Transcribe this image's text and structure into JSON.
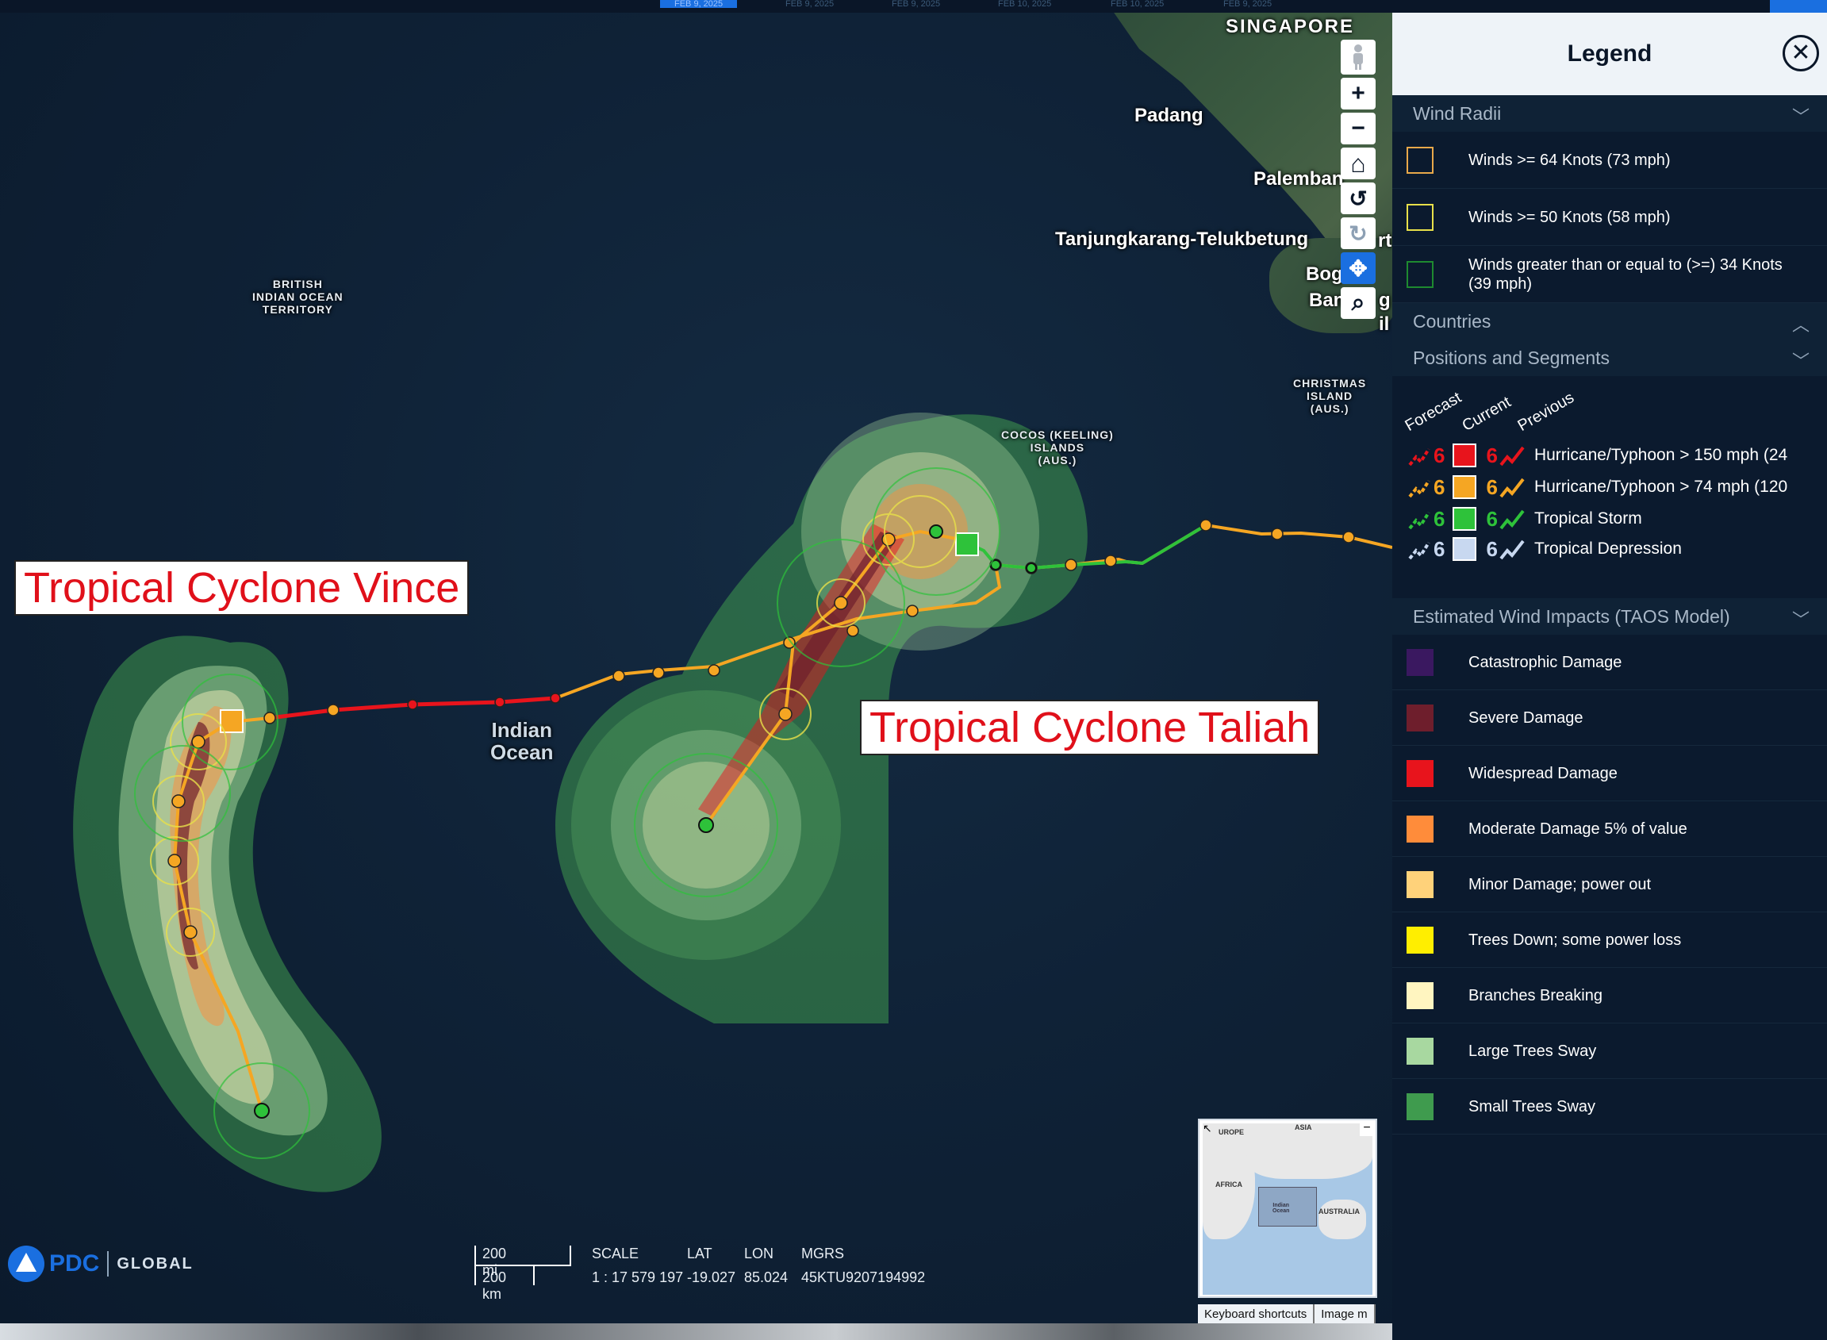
{
  "timeline": {
    "dates": [
      "FEB 9, 2025",
      "FEB 9, 2025",
      "FEB 9, 2025",
      "FEB 10, 2025",
      "FEB 10, 2025",
      "FEB 9, 2025"
    ]
  },
  "map": {
    "labels": {
      "singapore": "SINGAPORE",
      "padang": "Padang",
      "palembang": "Palemban",
      "tanjungkarang": "Tanjungkarang-Telukbetung",
      "bogor": "Bog",
      "bandung": "Ban",
      "north_cut": "rt",
      "cut_g": "g",
      "cut_il": "il",
      "biot": "BRITISH\nINDIAN OCEAN\nTERRITORY",
      "christmas": "CHRISTMAS\nISLAND\n(AUS.)",
      "cocos": "COCOS (KEELING)\nISLANDS\n(AUS.)",
      "ocean": "Indian\nOcean"
    },
    "cyclones": {
      "vince_label": "Tropical Cyclone Vince",
      "taliah_label": "Tropical Cyclone Taliah"
    },
    "colors": {
      "track_forecast": "#f5a623",
      "track_previous_hurricane": "#e8141c",
      "track_storm": "#2ec23a",
      "impact_small_trees": "#3f9b4e",
      "impact_large_trees": "#a8d8a0",
      "impact_branches": "#fff5c0",
      "impact_trees_down": "#ffee00",
      "impact_minor": "#ffd27a",
      "impact_moderate": "#ff8c3a",
      "impact_widespread": "#e8141c",
      "impact_severe": "#6e1e2c",
      "impact_catastrophic": "#3a1860"
    }
  },
  "controls": {
    "zoom_in": "+",
    "zoom_out": "−",
    "home": "⌂",
    "rotate_left": "↺",
    "rotate_right": "↻",
    "pan": "✥",
    "zoom_box": "⌕"
  },
  "status": {
    "scale_top": "200 mi",
    "scale_bottom": "200 km",
    "scale_label": "SCALE",
    "scale_value": "1 : 17 579 197",
    "lat_label": "LAT",
    "lat_value": "-19.027",
    "lon_label": "LON",
    "lon_value": "85.024",
    "mgrs_label": "MGRS",
    "mgrs_value": "45KTU9207194992"
  },
  "branding": {
    "pdc": "PDC",
    "global": "GLOBAL"
  },
  "overview": {
    "europe": "UROPE",
    "asia": "ASIA",
    "africa": "AFRICA",
    "australia": "AUSTRALIA",
    "indian_ocean": "Indian\nOcean",
    "minimize": "−"
  },
  "attribution": {
    "keyboard": "Keyboard shortcuts",
    "image": "Image m"
  },
  "legend": {
    "title": "Legend",
    "close": "✕",
    "wind_radii": {
      "header": "Wind Radii",
      "items": [
        {
          "label": "Winds >= 64 Knots (73 mph)",
          "color": "#e8a84a"
        },
        {
          "label": "Winds >= 50 Knots (58 mph)",
          "color": "#e8e04a"
        },
        {
          "label": "Winds greater than or equal to (>=) 34 Knots (39 mph)",
          "color": "#2ec23a"
        }
      ]
    },
    "countries": {
      "header": "Countries"
    },
    "positions": {
      "header": "Positions and Segments",
      "col_forecast": "Forecast",
      "col_current": "Current",
      "col_previous": "Previous",
      "rows": [
        {
          "label": "Hurricane/Typhoon > 150 mph (24",
          "color": "#e8141c"
        },
        {
          "label": "Hurricane/Typhoon > 74 mph (120",
          "color": "#f5a623"
        },
        {
          "label": "Tropical Storm",
          "color": "#2ec23a"
        },
        {
          "label": "Tropical Depression",
          "color": "#c8d8f0"
        }
      ]
    },
    "impacts": {
      "header": "Estimated Wind Impacts (TAOS Model)",
      "items": [
        {
          "label": "Catastrophic Damage",
          "color": "#3a1860"
        },
        {
          "label": "Severe Damage",
          "color": "#6e1e2c"
        },
        {
          "label": "Widespread Damage",
          "color": "#e8141c"
        },
        {
          "label": "Moderate Damage 5% of value",
          "color": "#ff8c3a"
        },
        {
          "label": "Minor Damage; power out",
          "color": "#ffd27a"
        },
        {
          "label": "Trees Down; some power loss",
          "color": "#ffee00"
        },
        {
          "label": "Branches Breaking",
          "color": "#fff5c0"
        },
        {
          "label": "Large Trees Sway",
          "color": "#a8d8a0"
        },
        {
          "label": "Small Trees Sway",
          "color": "#3f9b4e"
        }
      ]
    }
  }
}
